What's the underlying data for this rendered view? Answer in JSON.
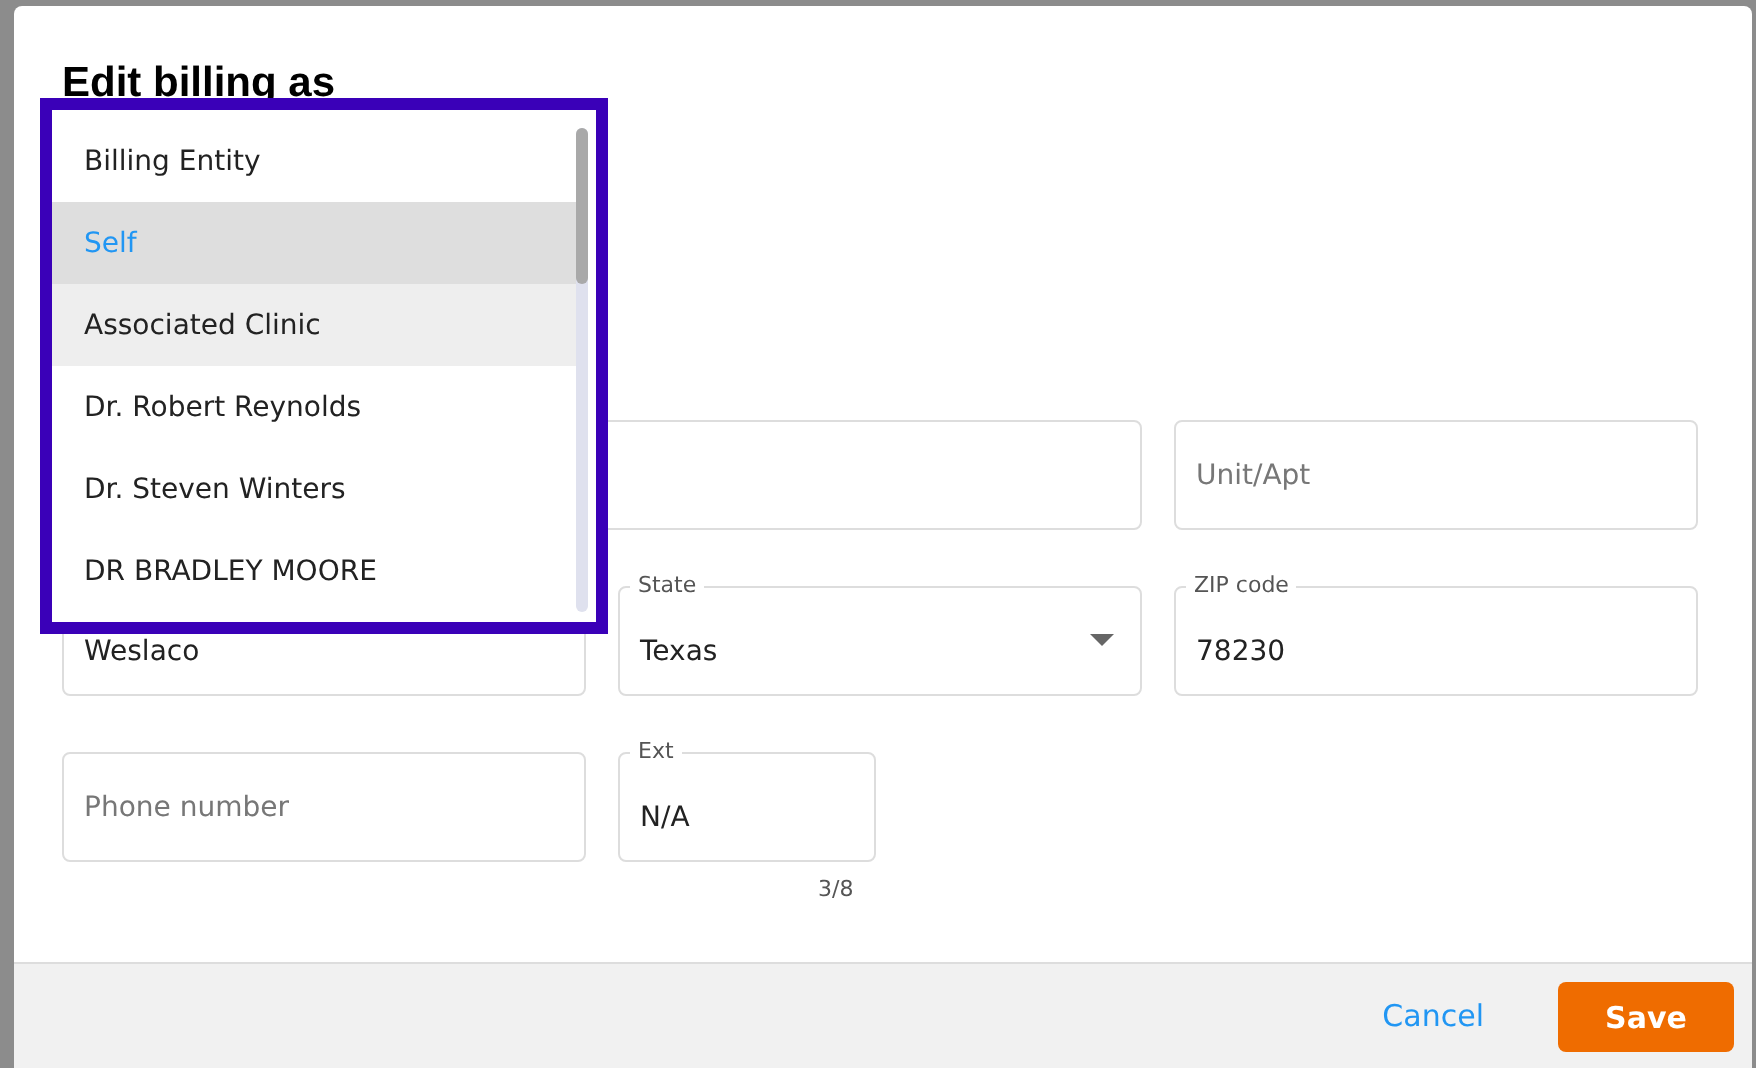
{
  "dialog": {
    "title": "Edit billing as"
  },
  "dropdown": {
    "options": [
      {
        "label": "Billing Entity",
        "selected": false,
        "hovered": false
      },
      {
        "label": "Self",
        "selected": true,
        "hovered": false
      },
      {
        "label": "Associated Clinic",
        "selected": false,
        "hovered": true
      },
      {
        "label": "Dr. Robert Reynolds",
        "selected": false,
        "hovered": false
      },
      {
        "label": "Dr. Steven Winters",
        "selected": false,
        "hovered": false
      },
      {
        "label": "DR BRADLEY MOORE",
        "selected": false,
        "hovered": false
      }
    ]
  },
  "fields": [
    {
      "kind": "text"
    },
    {
      "kind": "text",
      "placeholder": "Unit/Apt"
    },
    {
      "kind": "text",
      "value": "Weslaco"
    },
    {
      "kind": "select",
      "label": "State",
      "value": "Texas"
    },
    {
      "kind": "text",
      "label": "ZIP code",
      "value": "78230"
    },
    {
      "kind": "text",
      "placeholder": "Phone number"
    },
    {
      "kind": "text",
      "label": "Ext",
      "value": "N/A",
      "counter": "3/8"
    }
  ],
  "buttons": {
    "cancel": "Cancel",
    "save": "Save"
  }
}
